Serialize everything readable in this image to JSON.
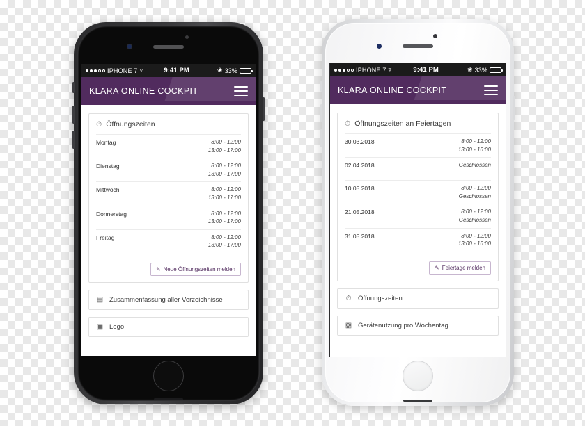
{
  "statusbar": {
    "carrier": "IPHONE 7",
    "wifi_icon": "wifi-icon",
    "time": "9:41 PM",
    "bluetooth_icon": "bluetooth-icon",
    "battery_percent": "33%",
    "battery_icon": "battery-icon",
    "signal_dots_filled": 3,
    "signal_dots_empty": 2
  },
  "header": {
    "title": "KLARA ONLINE COCKPIT",
    "menu_icon": "hamburger-menu-icon",
    "background_color": "#512B5E"
  },
  "left_phone": {
    "frame": "black",
    "card": {
      "icon": "clock-icon",
      "title": "Öffnungszeiten",
      "rows": [
        {
          "day": "Montag",
          "times": [
            "8:00 - 12:00",
            "13:00 - 17:00"
          ]
        },
        {
          "day": "Dienstag",
          "times": [
            "8:00 - 12:00",
            "13:00 - 17:00"
          ]
        },
        {
          "day": "Mittwoch",
          "times": [
            "8:00 - 12:00",
            "13:00 - 17:00"
          ]
        },
        {
          "day": "Donnerstag",
          "times": [
            "8:00 - 12:00",
            "13:00 - 17:00"
          ]
        },
        {
          "day": "Freitag",
          "times": [
            "8:00 - 12:00",
            "13:00 - 17:00"
          ]
        }
      ],
      "action_button": {
        "icon": "pencil-icon",
        "label": "Neue Öffnungszeiten melden",
        "color": "#512B5E"
      }
    },
    "buttons": [
      {
        "icon": "list-icon",
        "label": "Zusammenfassung aller Verzeichnisse"
      },
      {
        "icon": "camera-icon",
        "label": "Logo"
      }
    ]
  },
  "right_phone": {
    "frame": "white",
    "card": {
      "icon": "clock-icon",
      "title": "Öffnungszeiten an Feiertagen",
      "rows": [
        {
          "day": "30.03.2018",
          "times": [
            "8:00 - 12:00",
            "13:00 - 16:00"
          ]
        },
        {
          "day": "02.04.2018",
          "times": [
            "Geschlossen"
          ]
        },
        {
          "day": "10.05.2018",
          "times": [
            "8:00 - 12:00",
            "Geschlossen"
          ]
        },
        {
          "day": "21.05.2018",
          "times": [
            "8:00 - 12:00",
            "Geschlossen"
          ]
        },
        {
          "day": "31.05.2018",
          "times": [
            "8:00 - 12:00",
            "13:00 - 16:00"
          ]
        }
      ],
      "action_button": {
        "icon": "pencil-icon",
        "label": "Feiertage melden",
        "color": "#512B5E"
      }
    },
    "buttons": [
      {
        "icon": "clock-icon",
        "label": "Öffnungszeiten"
      },
      {
        "icon": "chart-icon",
        "label": "Gerätenutzung pro Wochentag"
      }
    ]
  }
}
